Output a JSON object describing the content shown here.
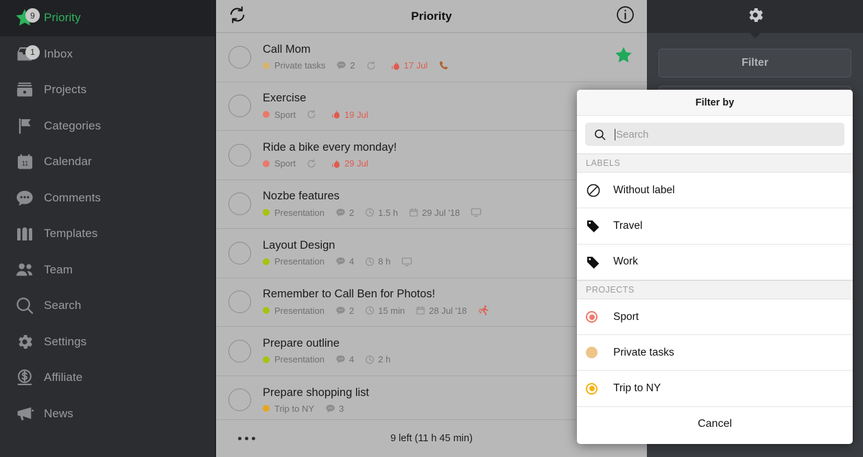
{
  "sidebar": {
    "items": [
      {
        "label": "Priority",
        "icon": "star-icon",
        "badge": "9",
        "active": true
      },
      {
        "label": "Inbox",
        "icon": "inbox-icon",
        "badge": "1",
        "active": false
      },
      {
        "label": "Projects",
        "icon": "projects-icon",
        "badge": "",
        "active": false
      },
      {
        "label": "Categories",
        "icon": "flag-icon",
        "badge": "",
        "active": false
      },
      {
        "label": "Calendar",
        "icon": "calendar-icon",
        "badge": "",
        "active": false
      },
      {
        "label": "Comments",
        "icon": "comment-icon",
        "badge": "",
        "active": false
      },
      {
        "label": "Templates",
        "icon": "templates-icon",
        "badge": "",
        "active": false
      },
      {
        "label": "Team",
        "icon": "team-icon",
        "badge": "",
        "active": false
      },
      {
        "label": "Search",
        "icon": "search-icon",
        "badge": "",
        "active": false
      },
      {
        "label": "Settings",
        "icon": "gear-icon",
        "badge": "",
        "active": false
      },
      {
        "label": "Affiliate",
        "icon": "dollar-coin-icon",
        "badge": "",
        "active": false
      },
      {
        "label": "News",
        "icon": "megaphone-icon",
        "badge": "",
        "active": false
      }
    ]
  },
  "header": {
    "title": "Priority",
    "sync_icon": "sync-icon",
    "info_icon": "info-icon"
  },
  "tasks": [
    {
      "name": "Call Mom",
      "project": "Private tasks",
      "project_color": "#d6b46a",
      "comments": "2",
      "recurring": true,
      "date": "17 Jul",
      "date_overdue": true,
      "category_icon": "phone-icon",
      "starred": true
    },
    {
      "name": "Exercise",
      "project": "Sport",
      "project_color": "#e8796b",
      "comments": "",
      "recurring": true,
      "date": "19 Jul",
      "date_overdue": true,
      "category_icon": "",
      "starred": false
    },
    {
      "name": "Ride a bike every monday!",
      "project": "Sport",
      "project_color": "#e8796b",
      "comments": "",
      "recurring": true,
      "date": "29 Jul",
      "date_overdue": true,
      "category_icon": "",
      "starred": false
    },
    {
      "name": "Nozbe features",
      "project": "Presentation",
      "project_color": "#a8c20e",
      "comments": "2",
      "recurring": false,
      "time": "1.5 h",
      "due": "29 Jul '18",
      "category_icon": "monitor-icon",
      "starred": false
    },
    {
      "name": "Layout Design",
      "project": "Presentation",
      "project_color": "#a8c20e",
      "comments": "4",
      "recurring": false,
      "time": "8 h",
      "due": "",
      "category_icon": "monitor-icon",
      "starred": false
    },
    {
      "name": "Remember to Call Ben for Photos!",
      "project": "Presentation",
      "project_color": "#a8c20e",
      "comments": "2",
      "recurring": false,
      "time": "15 min",
      "due": "28 Jul '18",
      "category_icon": "runner-icon",
      "starred": false
    },
    {
      "name": "Prepare outline",
      "project": "Presentation",
      "project_color": "#a8c20e",
      "comments": "4",
      "recurring": false,
      "time": "2 h",
      "due": "",
      "category_icon": "",
      "starred": false
    },
    {
      "name": "Prepare shopping list",
      "project": "Trip to NY",
      "project_color": "#e5a71f",
      "comments": "3",
      "recurring": false,
      "time": "",
      "due": "",
      "category_icon": "",
      "starred": false
    }
  ],
  "footer": {
    "more_icon": "more-dots-icon",
    "summary": "9 left (11 h 45 min)"
  },
  "right_panel": {
    "gear_icon": "gear-icon",
    "filter_label": "Filter"
  },
  "modal": {
    "title": "Filter by",
    "search_placeholder": "Search",
    "search_value": "",
    "search_icon": "search-icon",
    "sections": [
      {
        "header": "LABELS",
        "rows": [
          {
            "label": "Without label",
            "icon": "no-label-icon",
            "color": "#111111",
            "style": "slash"
          },
          {
            "label": "Travel",
            "icon": "tag-icon",
            "color": "#111111",
            "style": "tag"
          },
          {
            "label": "Work",
            "icon": "tag-icon",
            "color": "#111111",
            "style": "tag"
          }
        ]
      },
      {
        "header": "PROJECTS",
        "rows": [
          {
            "label": "Sport",
            "icon": "project-dot-icon",
            "color": "#f07a6b",
            "style": "ring"
          },
          {
            "label": "Private tasks",
            "icon": "project-dot-icon",
            "color": "#eec489",
            "style": "solid"
          },
          {
            "label": "Trip to NY",
            "icon": "project-dot-icon",
            "color": "#f5b312",
            "style": "ring"
          }
        ]
      }
    ],
    "cancel_label": "Cancel"
  },
  "colors": {
    "accent_green": "#2eb25c",
    "overdue_red": "#e05b4e",
    "sidebar_bg": "#2b2d31",
    "list_bg": "#b8b8b8"
  }
}
